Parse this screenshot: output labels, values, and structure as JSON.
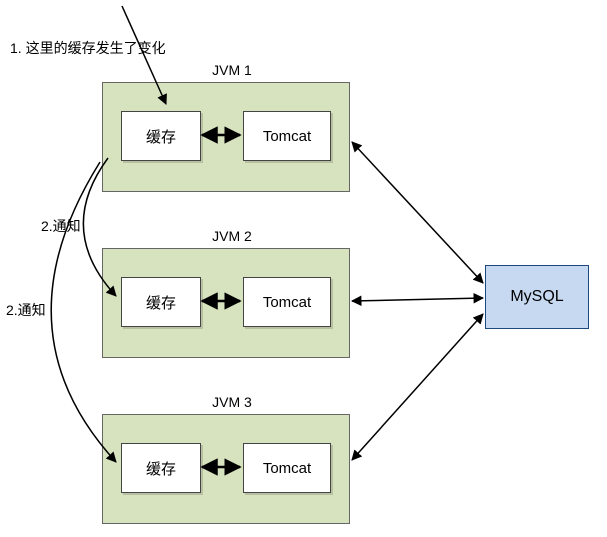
{
  "annotations": {
    "change": "1. 这里的缓存发生了变化",
    "notify_a": "2.通知",
    "notify_b": "2.通知"
  },
  "jvms": [
    {
      "label": "JVM 1",
      "cache": "缓存",
      "tomcat": "Tomcat"
    },
    {
      "label": "JVM 2",
      "cache": "缓存",
      "tomcat": "Tomcat"
    },
    {
      "label": "JVM 3",
      "cache": "缓存",
      "tomcat": "Tomcat"
    }
  ],
  "db": {
    "label": "MySQL"
  }
}
